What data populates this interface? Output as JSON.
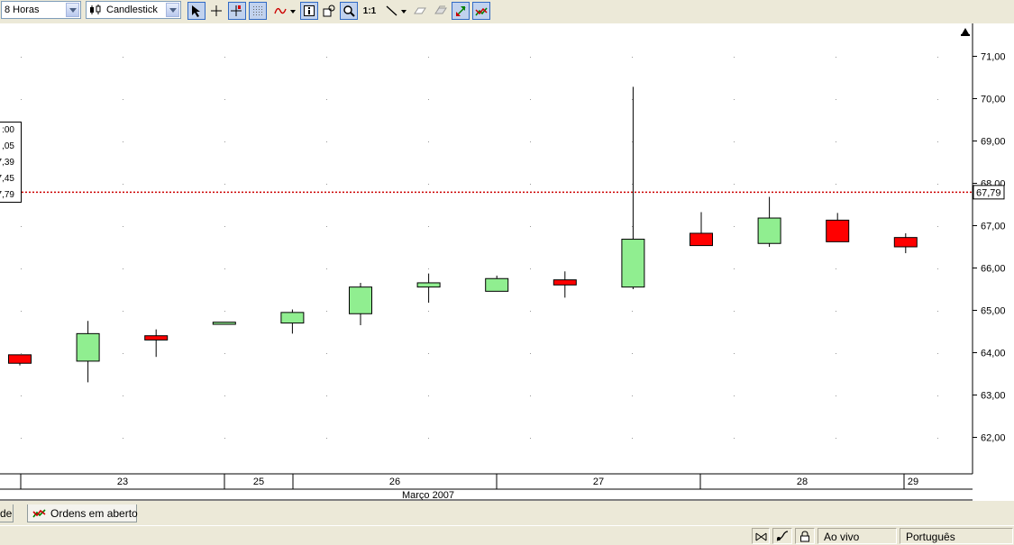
{
  "toolbar": {
    "period_select": "8 Horas",
    "chart_type_select": "Candlestick",
    "zoom_1to1_label": "1:1"
  },
  "chart_data": {
    "type": "candlestick",
    "ylim": [
      61.5,
      71.5
    ],
    "yticks": [
      "71,00",
      "70,00",
      "69,00",
      "68,00",
      "67,00",
      "66,00",
      "65,00",
      "64,00",
      "63,00",
      "62,00"
    ],
    "price_line_label": "67,79",
    "price_line_value": 67.79,
    "x_date_labels": [
      "23",
      "25",
      "26",
      "27",
      "28",
      "29"
    ],
    "x_month_label": "Março 2007",
    "colors": {
      "up": "#90ee90",
      "down": "#ff0000",
      "price_line": "#cc0000"
    },
    "candles": [
      {
        "open": 63.95,
        "close": 63.75,
        "high": 63.95,
        "low": 63.7
      },
      {
        "open": 63.8,
        "close": 64.45,
        "high": 64.75,
        "low": 63.3
      },
      {
        "open": 64.4,
        "close": 64.3,
        "high": 64.55,
        "low": 63.9
      },
      {
        "open": 64.67,
        "close": 64.72,
        "high": 64.72,
        "low": 64.67
      },
      {
        "open": 64.7,
        "close": 64.95,
        "high": 65.02,
        "low": 64.45
      },
      {
        "open": 64.92,
        "close": 65.55,
        "high": 65.65,
        "low": 64.65
      },
      {
        "open": 65.55,
        "close": 65.65,
        "high": 65.87,
        "low": 65.18
      },
      {
        "open": 65.45,
        "close": 65.75,
        "high": 65.82,
        "low": 65.45
      },
      {
        "open": 65.72,
        "close": 65.6,
        "high": 65.92,
        "low": 65.3
      },
      {
        "open": 65.55,
        "close": 66.68,
        "high": 70.28,
        "low": 65.5
      },
      {
        "open": 66.82,
        "close": 66.53,
        "high": 67.32,
        "low": 66.53
      },
      {
        "open": 66.58,
        "close": 67.18,
        "high": 67.68,
        "low": 66.5
      },
      {
        "open": 67.13,
        "close": 66.62,
        "high": 67.3,
        "low": 66.62
      },
      {
        "open": 66.72,
        "close": 66.5,
        "high": 66.82,
        "low": 66.35
      }
    ]
  },
  "info_box": {
    "lines": [
      ":00",
      ",05",
      "7,39",
      "7,45",
      "7,79"
    ]
  },
  "tabs": {
    "tab1_label": "de",
    "tab2_label": "Ordens em aberto"
  },
  "status": {
    "live_label": "Ao vivo",
    "language_label": "Português"
  }
}
